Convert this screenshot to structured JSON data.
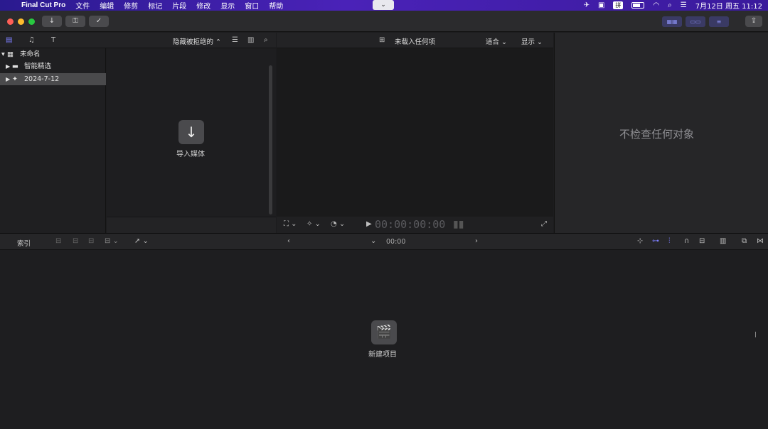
{
  "menubar": {
    "app_name": "Final Cut Pro",
    "items": [
      "文件",
      "编辑",
      "修剪",
      "标记",
      "片段",
      "修改",
      "显示",
      "窗口",
      "帮助"
    ],
    "ime": "拼",
    "clock": "7月12日 周五 11:12"
  },
  "browser": {
    "filter": "隐藏被拒绝的",
    "libraries": [
      {
        "label": "未命名"
      },
      {
        "label": "智能精选"
      },
      {
        "label": "2024-7-12"
      }
    ],
    "import_label": "导入媒体"
  },
  "viewer": {
    "title": "未载入任何项",
    "fit": "适合",
    "display": "显示",
    "timecode": "00:00:00:00"
  },
  "inspector": {
    "empty": "不检查任何对象"
  },
  "timeline": {
    "index": "索引",
    "timecode": "00:00",
    "new_project": "新建项目"
  },
  "colors": {
    "accent": "#7d7fff",
    "menubar": "#3a1fa6"
  }
}
